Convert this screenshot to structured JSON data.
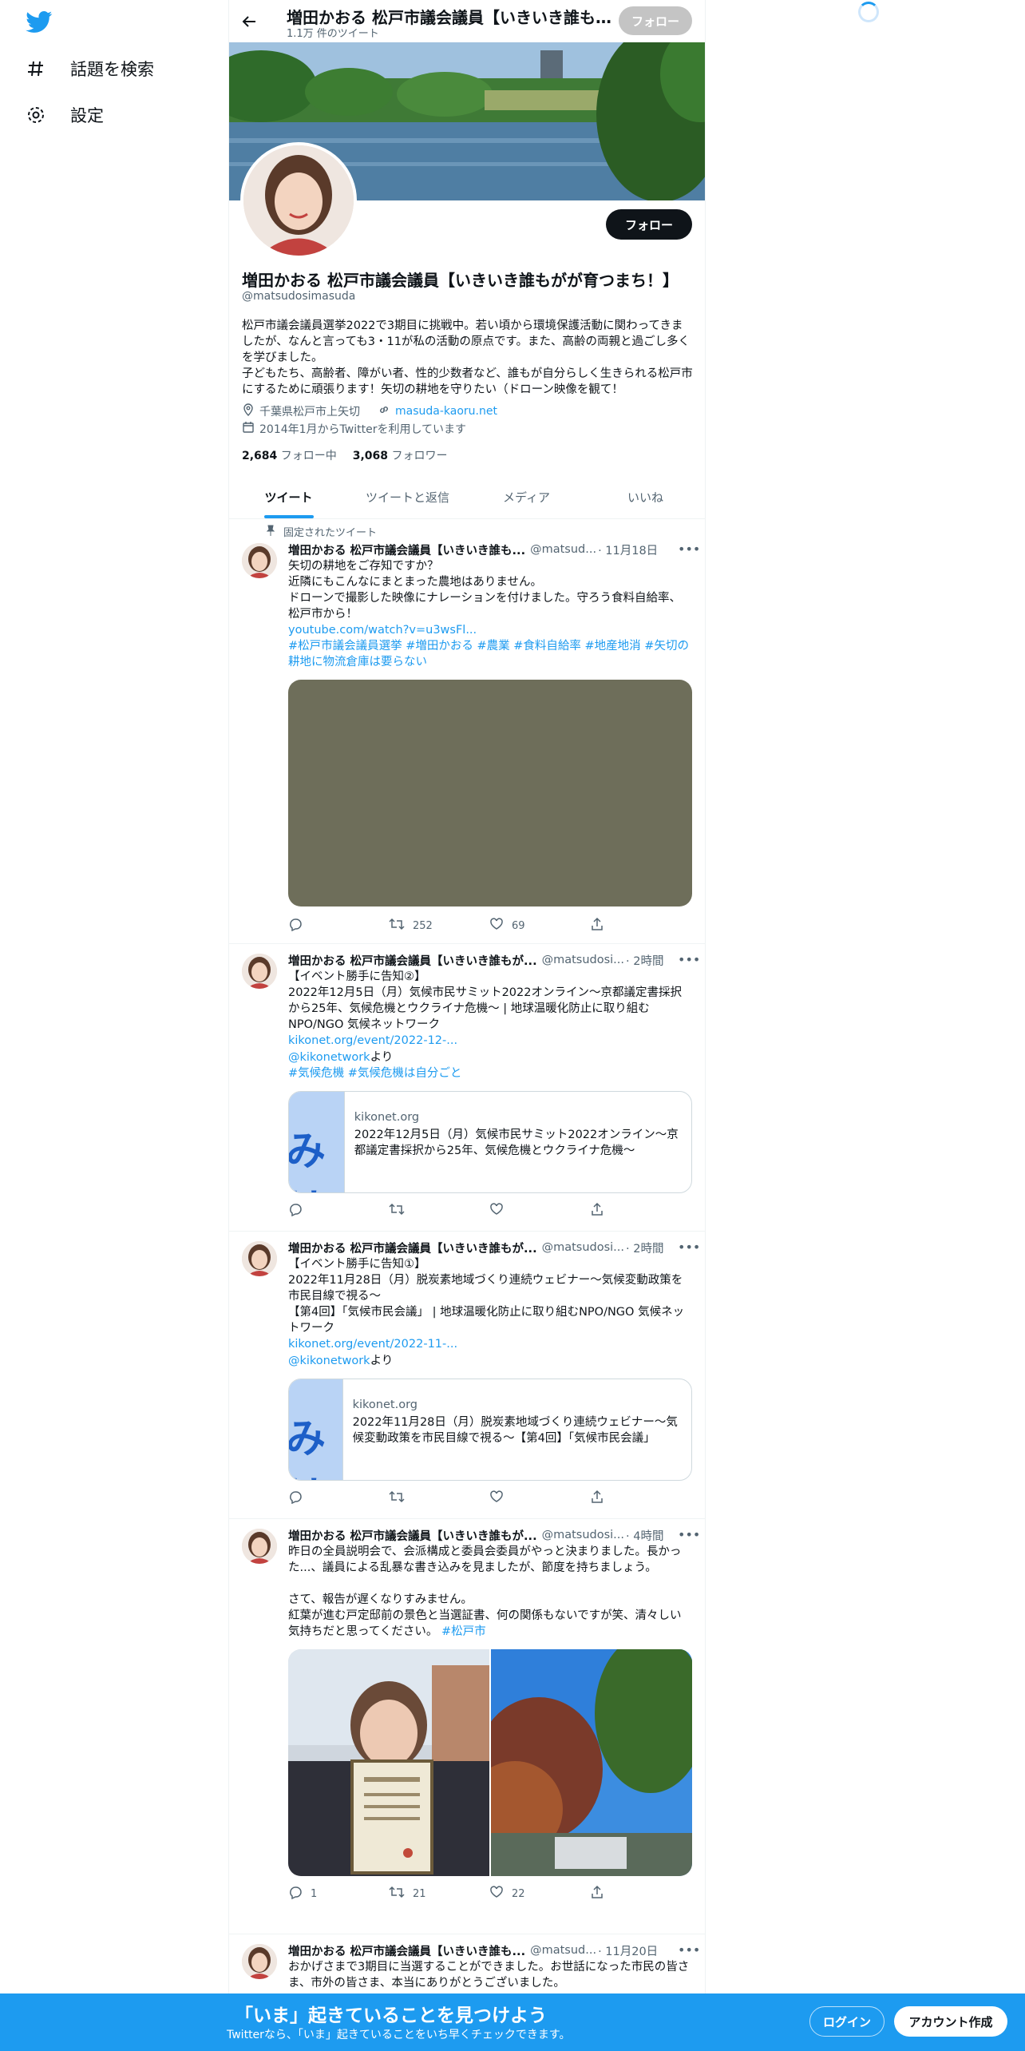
{
  "sidebar": {
    "logo": "twitter-bird",
    "items": [
      {
        "label": "話題を検索",
        "icon": "hashtag-icon"
      },
      {
        "label": "設定",
        "icon": "gear-icon"
      }
    ]
  },
  "header": {
    "title": "増田かおる 松戸市議会議員【いきいき誰もがが育つまち！】",
    "tweet_count": "1.1万 件のツイート",
    "follow_label": "フォロー"
  },
  "profile": {
    "name": "増田かおる 松戸市議会議員【いきいき誰もがが育つまち！】",
    "handle": "@matsudosimasuda",
    "bio": "松戸市議会議員選挙2022で3期目に挑戦中。若い頃から環境保護活動に関わってきましたが、なんと言っても3・11が私の活動の原点です。また、高齢の両親と過ごし多くを学びました。\n子どもたち、高齢者、障がい者、性的少数者など、誰もが自分らしく生きられる松戸市にするために頑張ります！矢切の耕地を守りたい（ドローン映像を観て！",
    "location": "千葉県松戸市上矢切",
    "website": "masuda-kaoru.net",
    "joined": "2014年1月からTwitterを利用しています",
    "following_count": "2,684",
    "following_label": "フォロー中",
    "followers_count": "3,068",
    "followers_label": "フォロワー",
    "follow_label": "フォロー"
  },
  "tabs": [
    "ツイート",
    "ツイートと返信",
    "メディア",
    "いいね"
  ],
  "pinned_label": "固定されたツイート",
  "tweets": [
    {
      "name": "増田かおる 松戸市議会議員【いきいき誰も...",
      "handle": "@matsud...",
      "time": "· 11月18日",
      "text": "矢切の耕地をご存知ですか？\n近隣にもこんなにまとまった農地はありません。\nドローンで撮影した映像にナレーションを付けました。守ろう食料自給率、松戸市から！",
      "link": "youtube.com/watch?v=u3wsFl...",
      "hashtags": "#松戸市議会議員選挙 #増田かおる #農業 #食料自給率 #地産地消 #矢切の耕地に物流倉庫は要らない",
      "replies": "",
      "retweets": "252",
      "likes": "69"
    },
    {
      "name": "増田かおる 松戸市議会議員【いきいき誰もが...",
      "handle": "@matsudosi...",
      "time": "· 2時間",
      "text": "【イベント勝手に告知②】\n2022年12月5日（月）気候市民サミット2022オンライン〜京都議定書採択から25年、気候危機とウクライナ危機〜 | 地球温暖化防止に取り組むNPO/NGO 気候ネットワーク",
      "link": "kikonet.org/event/2022-12-...",
      "mention": "@kikonetwork",
      "mention_suffix": "より",
      "hashtags": "#気候危機 #気候危機は自分ごと",
      "card_domain": "kikonet.org",
      "card_title": "2022年12月5日（月）気候市民サミット2022オンライン〜京都議定書採択から25年、気候危機とウクライナ危機〜",
      "card_thumb": "みはこち"
    },
    {
      "name": "増田かおる 松戸市議会議員【いきいき誰もが...",
      "handle": "@matsudosi...",
      "time": "· 2時間",
      "text": "【イベント勝手に告知①】\n2022年11月28日（月）脱炭素地域づくり連続ウェビナー〜気候変動政策を市民目線で視る〜\n【第4回】「気候市民会議」 | 地球温暖化防止に取り組むNPO/NGO 気候ネットワーク",
      "link": "kikonet.org/event/2022-11-...",
      "mention": "@kikonetwork",
      "mention_suffix": "より",
      "card_domain": "kikonet.org",
      "card_title": "2022年11月28日（月）脱炭素地域づくり連続ウェビナー〜気候変動政策を市民目線で視る〜【第4回】「気候市民会議」",
      "card_thumb": "みはこち"
    },
    {
      "name": "増田かおる 松戸市議会議員【いきいき誰もが...",
      "handle": "@matsudosi...",
      "time": "· 4時間",
      "text": "昨日の全員説明会で、会派構成と委員会委員がやっと決まりました。長かった...、議員による乱暴な書き込みを見ましたが、節度を持ちましょう。\n\nさて、報告が遅くなりすみません。\n紅葉が進む戸定邸前の景色と当選証書、何の関係もないですが笑、清々しい気持ちだと思ってください。",
      "hashtag_inline": "#松戸市",
      "replies": "1",
      "retweets": "21",
      "likes": "22"
    },
    {
      "name": "増田かおる 松戸市議会議員【いきいき誰も...",
      "handle": "@matsud...",
      "time": "· 11月20日",
      "text": "おかげさまで3期目に当選することができました。お世話になった市民の皆さま、市外の皆さま、本当にありがとうございました。"
    }
  ],
  "bottom_bar": {
    "title": "「いま」起きていることを見つけよう",
    "subtitle": "Twitterなら、「いま」起きていることをいち早くチェックできます。",
    "login": "ログイン",
    "signup": "アカウント作成"
  }
}
